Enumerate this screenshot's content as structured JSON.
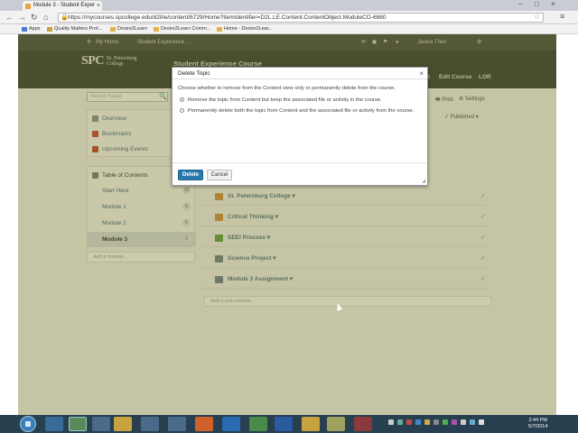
{
  "browser": {
    "tab_title": "Module 3 - Student Exper",
    "url": "https://mycourses.spcollege.edu/d2l/le/content/6729/Home?itemIdentifier=D2L.LE.Content.ContentObject.ModuleCO-6860",
    "bookmarks": [
      "Apps",
      "Quality Matters Prof...",
      "Desire2Learn",
      "Desire2Learn Comm...",
      "Home - Desire2Lear..."
    ]
  },
  "topnav": {
    "home": "My Home",
    "course": "Student Experience ...",
    "user": "Janice Thiel"
  },
  "banner": {
    "logo_main": "SPC",
    "logo_line1": "St. Petersburg",
    "logo_line2": "College",
    "course_title": "Student Experience Course",
    "link_edit_course": "Edit Course",
    "link_lor": "LOR",
    "link_partial": "d"
  },
  "sidebar": {
    "search_placeholder": "Search Topics",
    "items": [
      {
        "label": "Overview"
      },
      {
        "label": "Bookmarks"
      },
      {
        "label": "Upcoming Events"
      }
    ],
    "toc_label": "Table of Contents",
    "modules": [
      {
        "label": "Start Here",
        "count": "12"
      },
      {
        "label": "Module 1",
        "count": "0"
      },
      {
        "label": "Module 2",
        "count": "0"
      },
      {
        "label": "Module 3",
        "count": "0"
      }
    ],
    "add_module": "Add a module..."
  },
  "toolbar": {
    "print": "Print",
    "settings": "Settings",
    "published": "Published"
  },
  "topics": [
    {
      "label": "St. Petersburg College"
    },
    {
      "label": "Critical Thinking"
    },
    {
      "label": "SEEI Process"
    },
    {
      "label": "Science Project"
    },
    {
      "label": "Module 3 Assignment"
    }
  ],
  "add_sub_module": "Add a sub-module...",
  "dialog": {
    "title": "Delete Topic",
    "instruction": "Choose whether to remove from the Content view only or permanently delete from the course.",
    "option1": "Remove the topic from Content but keep the associated file or activity in the course.",
    "option2": "Permanently delete both the topic from Content and the associated file or activity from the course.",
    "delete_label": "Delete",
    "cancel_label": "Cancel"
  },
  "taskbar": {
    "time": "2:44 PM",
    "date": "5/7/2014"
  },
  "colors": {
    "primary_button": "#2a7ab0",
    "nav_bg": "#3e4442",
    "banner_bg": "#2c3432"
  }
}
